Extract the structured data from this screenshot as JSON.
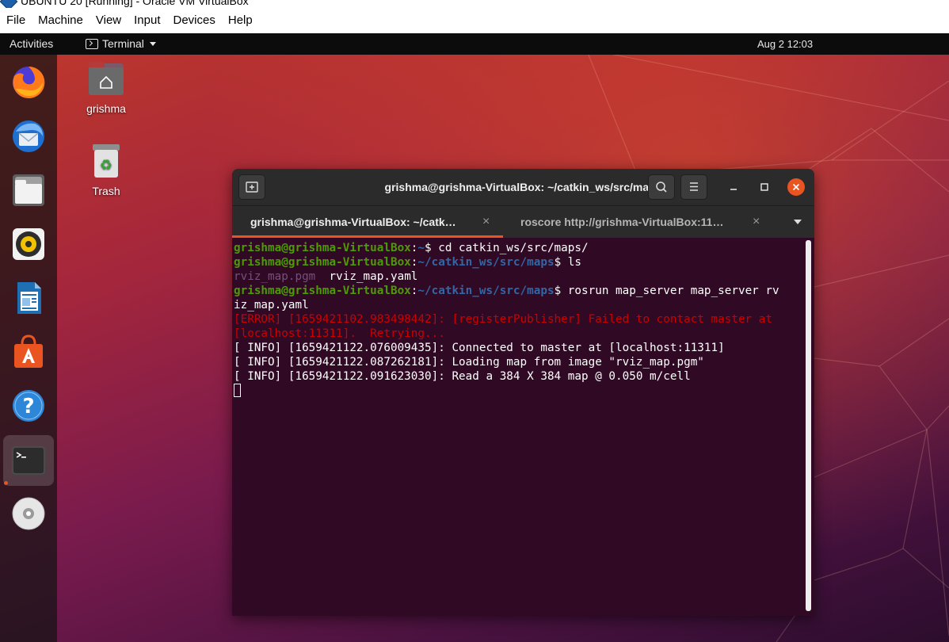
{
  "host": {
    "title": "UBUNTU 20 [Running] - Oracle VM VirtualBox",
    "menu": [
      "File",
      "Machine",
      "View",
      "Input",
      "Devices",
      "Help"
    ]
  },
  "top_bar": {
    "activities": "Activities",
    "app_name": "Terminal",
    "clock": "Aug 2  12:03"
  },
  "dock": {
    "items": [
      {
        "name": "firefox",
        "icon": "firefox-icon"
      },
      {
        "name": "thunderbird",
        "icon": "thunderbird-icon"
      },
      {
        "name": "files",
        "icon": "files-icon"
      },
      {
        "name": "rhythmbox",
        "icon": "rhythmbox-icon"
      },
      {
        "name": "libreoffice-writer",
        "icon": "writer-icon"
      },
      {
        "name": "ubuntu-software",
        "icon": "software-icon"
      },
      {
        "name": "help",
        "icon": "help-icon"
      },
      {
        "name": "terminal",
        "icon": "terminal-icon",
        "active": true
      },
      {
        "name": "dvd",
        "icon": "disc-icon"
      }
    ]
  },
  "desktop_icons": {
    "home": "grishma",
    "trash": "Trash"
  },
  "terminal": {
    "window_title": "grishma@grishma-VirtualBox: ~/catkin_ws/src/maps",
    "tabs": [
      {
        "label": "grishma@grishma-VirtualBox: ~/catk…",
        "active": true
      },
      {
        "label": "roscore http://grishma-VirtualBox:11…",
        "active": false
      }
    ],
    "tab_close_glyph": "×",
    "lines": {
      "l1_user": "grishma@grishma-VirtualBox",
      "l1_sep": ":",
      "l1_path": "~",
      "l1_cmd": "$ cd catkin_ws/src/maps/",
      "l2_user": "grishma@grishma-VirtualBox",
      "l2_sep": ":",
      "l2_path": "~/catkin_ws/src/maps",
      "l2_cmd": "$ ls",
      "l3_pgm": "rviz_map.pgm",
      "l3_rest": "  rviz_map.yaml",
      "l4_user": "grishma@grishma-VirtualBox",
      "l4_sep": ":",
      "l4_path": "~/catkin_ws/src/maps",
      "l4_cmd": "$ rosrun map_server map_server rv",
      "l5": "iz_map.yaml",
      "l6": "[ERROR] [1659421102.983498442]: [registerPublisher] Failed to contact master at",
      "l7": "[localhost:11311].  Retrying...",
      "l8": "[ INFO] [1659421122.076009435]: Connected to master at [localhost:11311]",
      "l9": "[ INFO] [1659421122.087262181]: Loading map from image \"rviz_map.pgm\"",
      "l10": "[ INFO] [1659421122.091623030]: Read a 384 X 384 map @ 0.050 m/cell"
    }
  },
  "colors": {
    "ubuntu_orange": "#e95420",
    "terminal_bg": "#300a24",
    "prompt_user": "#4e9a06",
    "prompt_path": "#3465a4",
    "error": "#cc0000"
  }
}
